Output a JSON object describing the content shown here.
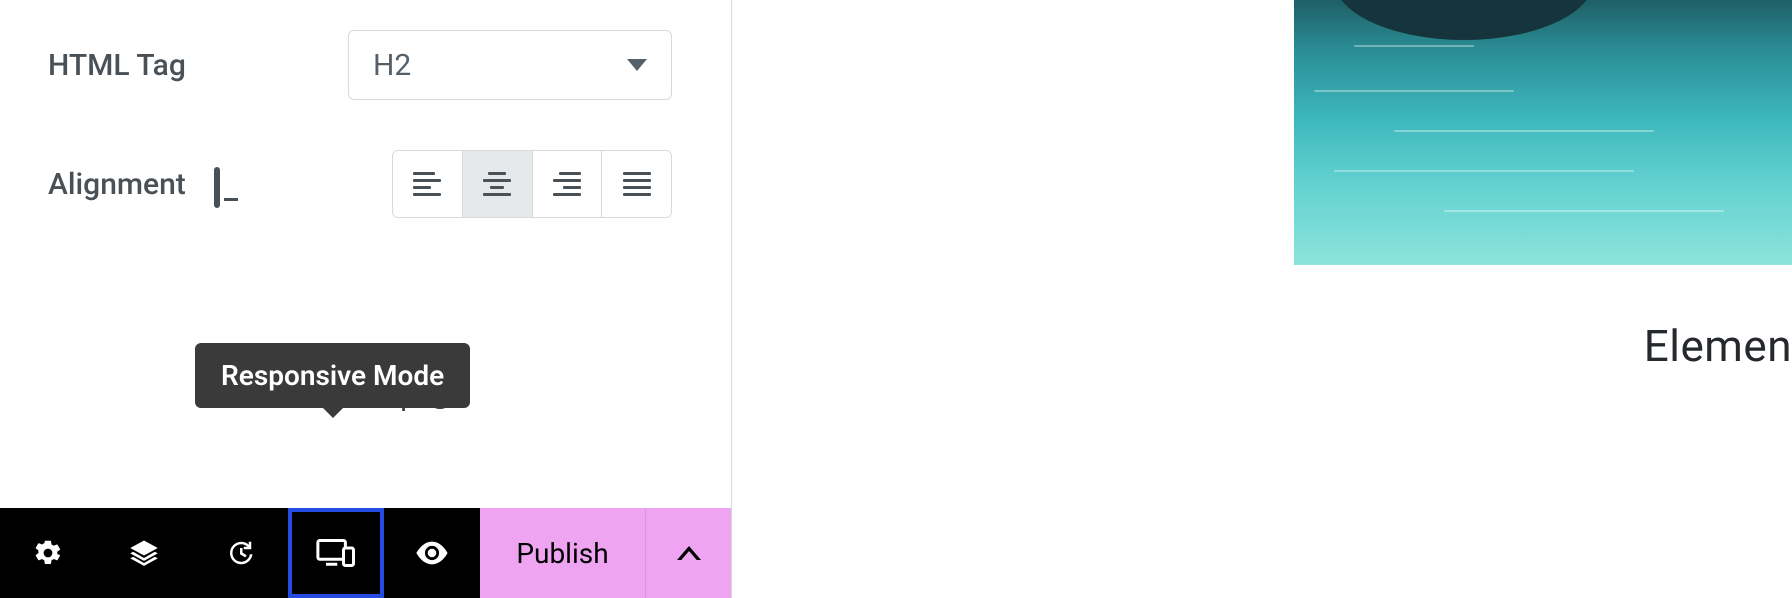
{
  "panel": {
    "html_tag": {
      "label": "HTML Tag",
      "value": "H2"
    },
    "alignment": {
      "label": "Alignment",
      "active_index": 1
    },
    "help_text": "Need Help",
    "tooltip": "Responsive Mode"
  },
  "bottom_bar": {
    "publish_label": "Publish"
  },
  "canvas": {
    "heading_preview": "Elemen"
  }
}
